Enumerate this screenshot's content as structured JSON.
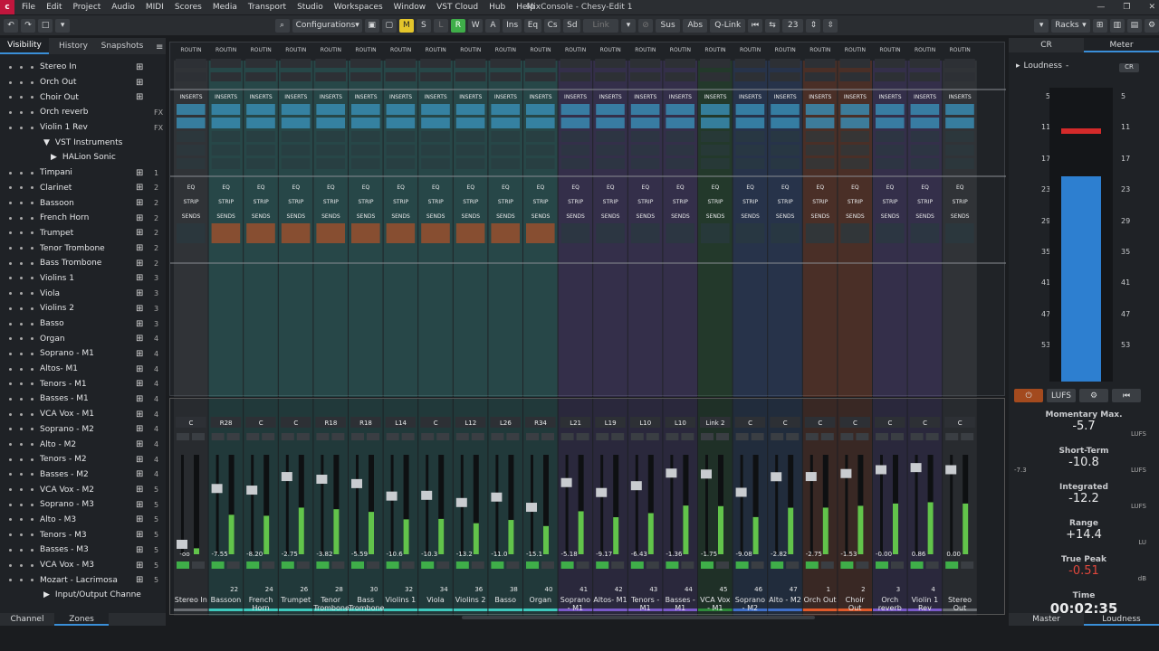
{
  "window": {
    "title": "MixConsole - Chesy-Edit 1",
    "logo": "logo-c"
  },
  "menu": [
    "File",
    "Edit",
    "Project",
    "Audio",
    "MIDI",
    "Scores",
    "Media",
    "Transport",
    "Studio",
    "Workspaces",
    "Window",
    "VST Cloud",
    "Hub",
    "Help"
  ],
  "toolbar": {
    "configurations": "Configurations",
    "m": "M",
    "s": "S",
    "l": "L",
    "r": "R",
    "w": "W",
    "a": "A",
    "ins": "Ins",
    "eq": "Eq",
    "cs": "Cs",
    "sd": "Sd",
    "link": "Link",
    "sus": "Sus",
    "abs": "Abs",
    "qlink": "Q-Link",
    "channel_count": "23",
    "racks": "Racks"
  },
  "left_tabs": [
    "Visibility",
    "History",
    "Snapshots"
  ],
  "tracks": [
    {
      "name": "Stereo In",
      "num": ""
    },
    {
      "name": "Orch Out",
      "num": ""
    },
    {
      "name": "Choir Out",
      "num": ""
    },
    {
      "name": "Orch reverb",
      "num": "FX"
    },
    {
      "name": "Violin 1 Rev",
      "num": "FX"
    },
    {
      "name": "VST Instruments",
      "num": ""
    },
    {
      "name": "HALion Sonic",
      "num": ""
    },
    {
      "name": "Timpani",
      "num": "1"
    },
    {
      "name": "Clarinet",
      "num": "2"
    },
    {
      "name": "Bassoon",
      "num": "2"
    },
    {
      "name": "French Horn",
      "num": "2"
    },
    {
      "name": "Trumpet",
      "num": "2"
    },
    {
      "name": "Tenor Trombone",
      "num": "2"
    },
    {
      "name": "Bass Trombone",
      "num": "2"
    },
    {
      "name": "Violins 1",
      "num": "3"
    },
    {
      "name": "Viola",
      "num": "3"
    },
    {
      "name": "Violins 2",
      "num": "3"
    },
    {
      "name": "Basso",
      "num": "3"
    },
    {
      "name": "Organ",
      "num": "4"
    },
    {
      "name": "Soprano - M1",
      "num": "4"
    },
    {
      "name": "Altos- M1",
      "num": "4"
    },
    {
      "name": "Tenors - M1",
      "num": "4"
    },
    {
      "name": "Basses - M1",
      "num": "4"
    },
    {
      "name": "VCA Vox - M1",
      "num": "4"
    },
    {
      "name": "Soprano - M2",
      "num": "4"
    },
    {
      "name": "Alto - M2",
      "num": "4"
    },
    {
      "name": "Tenors - M2",
      "num": "4"
    },
    {
      "name": "Basses - M2",
      "num": "4"
    },
    {
      "name": "VCA Vox - M2",
      "num": "5"
    },
    {
      "name": "Soprano - M3",
      "num": "5"
    },
    {
      "name": "Alto - M3",
      "num": "5"
    },
    {
      "name": "Tenors - M3",
      "num": "5"
    },
    {
      "name": "Basses - M3",
      "num": "5"
    },
    {
      "name": "VCA Vox - M3",
      "num": "5"
    },
    {
      "name": "Mozart - Lacrimosa",
      "num": "5"
    },
    {
      "name": "Input/Output Channe",
      "num": ""
    }
  ],
  "left_bottom": [
    "Channel",
    "Zones"
  ],
  "rack_labels": {
    "routing": "ROUTIN",
    "inserts": "INSERTS",
    "eq": "EQ",
    "strip": "STRIP",
    "sends": "SENDS"
  },
  "channels": [
    {
      "name": "Stereo In",
      "num": "",
      "color": "#6a6e73",
      "pan": "C",
      "vol": "-oo"
    },
    {
      "name": "Bassoon",
      "num": "22",
      "color": "#3ec9bd",
      "pan": "R28",
      "vol": "-7.55"
    },
    {
      "name": "French Horn",
      "num": "24",
      "color": "#3ec9bd",
      "pan": "C",
      "vol": "-8.20"
    },
    {
      "name": "Trumpet",
      "num": "26",
      "color": "#3ec9bd",
      "pan": "C",
      "vol": "-2.75"
    },
    {
      "name": "Tenor Trombone",
      "num": "28",
      "color": "#3ec9bd",
      "pan": "R18",
      "vol": "-3.82"
    },
    {
      "name": "Bass Trombone",
      "num": "30",
      "color": "#3ec9bd",
      "pan": "R18",
      "vol": "-5.59"
    },
    {
      "name": "Violins 1",
      "num": "32",
      "color": "#3ec9bd",
      "pan": "L14",
      "vol": "-10.6"
    },
    {
      "name": "Viola",
      "num": "34",
      "color": "#3ec9bd",
      "pan": "C",
      "vol": "-10.3"
    },
    {
      "name": "Violins 2",
      "num": "36",
      "color": "#3ec9bd",
      "pan": "L12",
      "vol": "-13.2"
    },
    {
      "name": "Basso",
      "num": "38",
      "color": "#3ec9bd",
      "pan": "L26",
      "vol": "-11.0"
    },
    {
      "name": "Organ",
      "num": "40",
      "color": "#3ec9bd",
      "pan": "R34",
      "vol": "-15.1"
    },
    {
      "name": "Soprano - M1",
      "num": "41",
      "color": "#7a5ac9",
      "pan": "L21",
      "vol": "-5.18"
    },
    {
      "name": "Altos- M1",
      "num": "42",
      "color": "#7a5ac9",
      "pan": "L19",
      "vol": "-9.17"
    },
    {
      "name": "Tenors - M1",
      "num": "43",
      "color": "#7a5ac9",
      "pan": "L10",
      "vol": "-6.43"
    },
    {
      "name": "Basses - M1",
      "num": "44",
      "color": "#7a5ac9",
      "pan": "L10",
      "vol": "-1.36"
    },
    {
      "name": "VCA Vox - M1",
      "num": "45",
      "color": "#2e8a3a",
      "pan": "Link 2",
      "vol": "-1.75"
    },
    {
      "name": "Soprano - M2",
      "num": "46",
      "color": "#3f6fc9",
      "pan": "C",
      "vol": "-9.08"
    },
    {
      "name": "Alto - M2",
      "num": "47",
      "color": "#3f6fc9",
      "pan": "C",
      "vol": "-2.82"
    },
    {
      "name": "Orch Out",
      "num": "1",
      "color": "#e05a2b",
      "pan": "C",
      "vol": "-2.75"
    },
    {
      "name": "Choir Out",
      "num": "2",
      "color": "#e05a2b",
      "pan": "C",
      "vol": "-1.53"
    },
    {
      "name": "Orch reverb",
      "num": "3",
      "color": "#7a5ac9",
      "pan": "C",
      "vol": "-0.00"
    },
    {
      "name": "Violin 1 Rev",
      "num": "4",
      "color": "#7a5ac9",
      "pan": "C",
      "vol": "0.86"
    },
    {
      "name": "Stereo Out",
      "num": "",
      "color": "#6a6e73",
      "pan": "C",
      "vol": "0.00"
    }
  ],
  "right_tabs": [
    "CR",
    "Meter"
  ],
  "loudness": {
    "label": "Loudness",
    "scale": [
      "5",
      "11",
      "17",
      "23",
      "29",
      "35",
      "41",
      "47",
      "53"
    ],
    "momentary": {
      "label": "Momentary Max.",
      "value": "-5.7",
      "unit": "LUFS"
    },
    "short": {
      "label": "Short-Term",
      "value": "-10.8",
      "unit": "LUFS",
      "aux": "-7.3"
    },
    "integrated": {
      "label": "Integrated",
      "value": "-12.2",
      "unit": "LUFS"
    },
    "range": {
      "label": "Range",
      "value": "+14.4",
      "unit": "LU"
    },
    "truepeak": {
      "label": "True Peak",
      "value": "-0.51",
      "unit": "dB"
    },
    "time": {
      "label": "Time",
      "value": "00:02:35"
    },
    "level": 0.7,
    "lufs_button": "LUFS"
  },
  "right_bottom": [
    "Master",
    "Loudness"
  ]
}
